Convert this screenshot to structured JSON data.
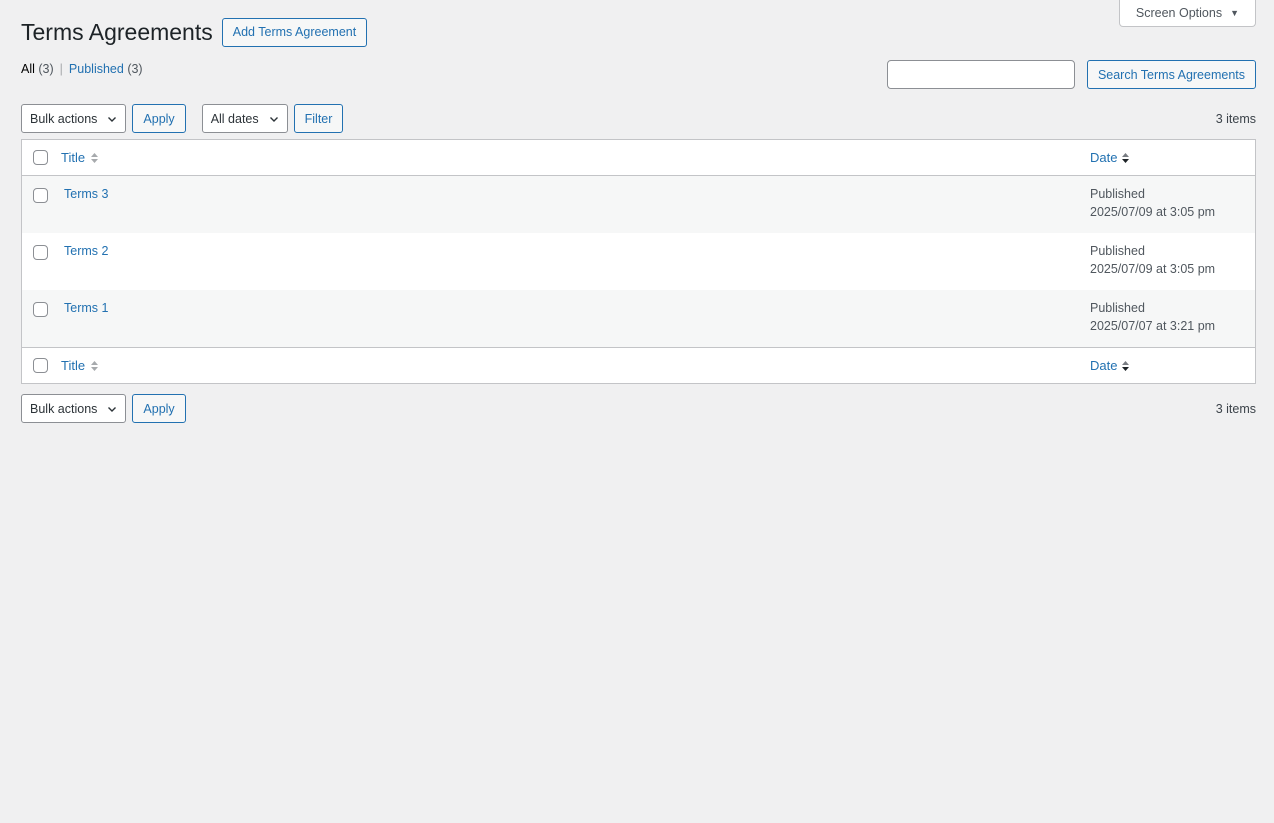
{
  "screen_options": {
    "label": "Screen Options"
  },
  "header": {
    "title": "Terms Agreements",
    "add_button": "Add Terms Agreement"
  },
  "views": {
    "all_label": "All",
    "all_count": "(3)",
    "separator": "|",
    "published_label": "Published",
    "published_count": "(3)"
  },
  "search": {
    "value": "",
    "placeholder": "",
    "button": "Search Terms Agreements"
  },
  "tablenav_top": {
    "bulk_actions": "Bulk actions",
    "apply": "Apply",
    "dates": "All dates",
    "filter": "Filter",
    "items": "3 items"
  },
  "tablenav_bottom": {
    "bulk_actions": "Bulk actions",
    "apply": "Apply",
    "items": "3 items"
  },
  "table": {
    "columns": {
      "title": "Title",
      "date": "Date"
    },
    "rows": [
      {
        "title": "Terms 3",
        "status": "Published",
        "date": "2025/07/09 at 3:05 pm"
      },
      {
        "title": "Terms 2",
        "status": "Published",
        "date": "2025/07/09 at 3:05 pm"
      },
      {
        "title": "Terms 1",
        "status": "Published",
        "date": "2025/07/07 at 3:21 pm"
      }
    ]
  },
  "colors": {
    "link": "#2271b1",
    "background": "#f0f0f1",
    "border": "#c3c4c7"
  }
}
